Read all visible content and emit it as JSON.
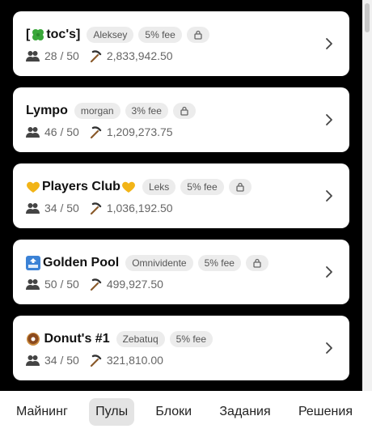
{
  "pools": [
    {
      "name_prefix": "[",
      "name_icon": "clover",
      "name_suffix": "toc's]",
      "owner": "Aleksey",
      "fee": "5% fee",
      "members": "28 / 50",
      "hashrate": "2,833,942.50"
    },
    {
      "name_prefix": "",
      "name_icon": "",
      "name_suffix": "Lympo",
      "owner": "morgan",
      "fee": "3% fee",
      "members": "46 / 50",
      "hashrate": "1,209,273.75"
    },
    {
      "name_prefix": "",
      "name_icon": "heart",
      "name_suffix": "Players Club",
      "name_trail_icon": "heart",
      "owner": "Leks",
      "fee": "5% fee",
      "members": "34 / 50",
      "hashrate": "1,036,192.50"
    },
    {
      "name_prefix": "",
      "name_icon": "top-arrow",
      "name_suffix": "Golden Pool",
      "owner": "Omnividente",
      "fee": "5% fee",
      "members": "50 / 50",
      "hashrate": "499,927.50"
    },
    {
      "name_prefix": "",
      "name_icon": "donut",
      "name_suffix": " Donut's #1",
      "owner": "Zebatuq",
      "fee": "5% fee",
      "members": "34 / 50",
      "hashrate": "321,810.00"
    }
  ],
  "nav": {
    "items": [
      "Майнинг",
      "Пулы",
      "Блоки",
      "Задания",
      "Решения"
    ],
    "active": "Пулы"
  },
  "colors": {
    "background": "#000000",
    "card": "#ffffff",
    "pill": "#ececec",
    "nav_active": "#e4e4e4"
  }
}
